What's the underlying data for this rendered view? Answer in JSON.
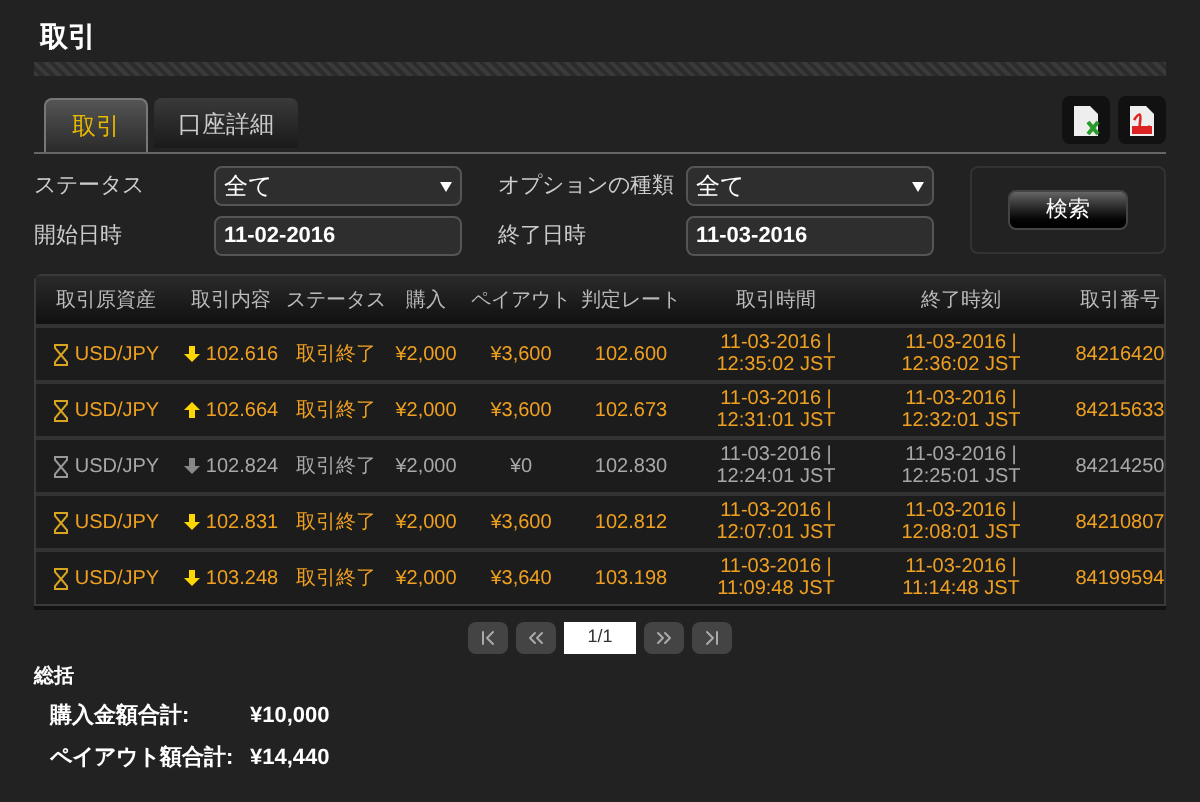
{
  "page_title": "取引",
  "tabs": [
    {
      "label": "取引",
      "selected": true
    },
    {
      "label": "口座詳細",
      "selected": false
    }
  ],
  "filters": {
    "status_label": "ステータス",
    "status_value": "全て",
    "option_type_label": "オプションの種類",
    "option_type_value": "全て",
    "start_label": "開始日時",
    "start_value": "11-02-2016",
    "end_label": "終了日時",
    "end_value": "11-03-2016",
    "search_button": "検索"
  },
  "table": {
    "columns": [
      "取引原資産",
      "取引内容",
      "ステータス",
      "購入",
      "ペイアウト",
      "判定レート",
      "取引時間",
      "終了時刻",
      "取引番号"
    ],
    "rows": [
      {
        "highlighted": true,
        "asset": "USD/JPY",
        "rising": false,
        "strike": "102.616",
        "status": "取引終了",
        "purchase": "¥2,000",
        "payout": "¥3,600",
        "rate": "102.600",
        "start_date": "11-03-2016 |",
        "start_time": "12:35:02 JST",
        "end_date": "11-03-2016 |",
        "end_time": "12:36:02 JST",
        "id": "84216420"
      },
      {
        "highlighted": true,
        "asset": "USD/JPY",
        "rising": true,
        "strike": "102.664",
        "status": "取引終了",
        "purchase": "¥2,000",
        "payout": "¥3,600",
        "rate": "102.673",
        "start_date": "11-03-2016 |",
        "start_time": "12:31:01 JST",
        "end_date": "11-03-2016 |",
        "end_time": "12:32:01 JST",
        "id": "84215633"
      },
      {
        "highlighted": false,
        "asset": "USD/JPY",
        "rising": false,
        "strike": "102.824",
        "status": "取引終了",
        "purchase": "¥2,000",
        "payout": "¥0",
        "rate": "102.830",
        "start_date": "11-03-2016 |",
        "start_time": "12:24:01 JST",
        "end_date": "11-03-2016 |",
        "end_time": "12:25:01 JST",
        "id": "84214250"
      },
      {
        "highlighted": true,
        "asset": "USD/JPY",
        "rising": false,
        "strike": "102.831",
        "status": "取引終了",
        "purchase": "¥2,000",
        "payout": "¥3,600",
        "rate": "102.812",
        "start_date": "11-03-2016 |",
        "start_time": "12:07:01 JST",
        "end_date": "11-03-2016 |",
        "end_time": "12:08:01 JST",
        "id": "84210807"
      },
      {
        "highlighted": true,
        "asset": "USD/JPY",
        "rising": false,
        "strike": "103.248",
        "status": "取引終了",
        "purchase": "¥2,000",
        "payout": "¥3,640",
        "rate": "103.198",
        "start_date": "11-03-2016 |",
        "start_time": "11:09:48 JST",
        "end_date": "11-03-2016 |",
        "end_time": "11:14:48 JST",
        "id": "84199594"
      }
    ]
  },
  "pagination": {
    "page": "1/1"
  },
  "summary": {
    "title": "総括",
    "items": [
      {
        "label": "購入金額合計:",
        "value": "¥10,000"
      },
      {
        "label": "ペイアウト額合計:",
        "value": "¥14,440"
      }
    ]
  }
}
